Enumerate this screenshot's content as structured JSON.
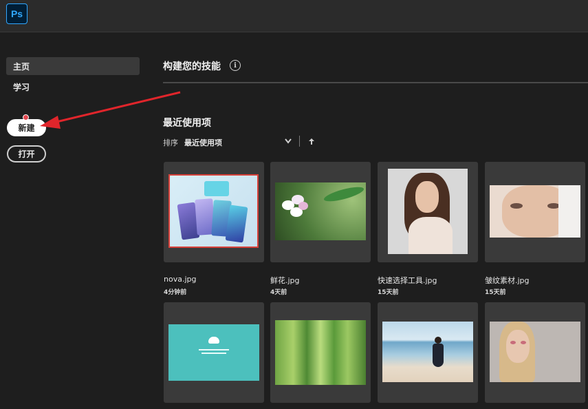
{
  "app": {
    "logo_text": "Ps"
  },
  "sidebar": {
    "items": [
      {
        "label": "主页"
      },
      {
        "label": "学习"
      }
    ],
    "new_button": "新建",
    "open_button": "打开"
  },
  "main": {
    "skills_title": "构建您的技能",
    "recent_title": "最近使用项",
    "sort_label": "排序",
    "sort_value": "最近使用项"
  },
  "files": [
    {
      "name": "nova.jpg",
      "time": "4分钟前"
    },
    {
      "name": "鲜花.jpg",
      "time": "4天前"
    },
    {
      "name": "快速选择工具.jpg",
      "time": "15天前"
    },
    {
      "name": "皱纹素材.jpg",
      "time": "15天前"
    }
  ],
  "colors": {
    "ps_blue": "#31a8ff",
    "annotation_arrow": "#e0252b"
  }
}
